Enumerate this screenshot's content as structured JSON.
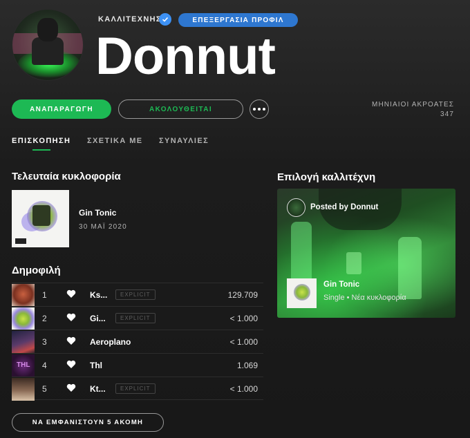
{
  "header": {
    "artist_label": "ΚΑΛΛΙΤΕΧΝΗΣ",
    "edit_profile_label": "ΕΠΕΞΕΡΓΑΣΙΑ ΠΡΟΦΙΛ",
    "artist_name": "Donnut"
  },
  "actions": {
    "play_label": "ΑΝΑΠΑΡΑΓΩΓΗ",
    "follow_label": "ΑΚΟΛΟΥΘΕΙΤΑΙ",
    "more_icon": "more-options-icon",
    "monthly_listeners_label": "ΜΗΝΙΑΙΟΙ ΑΚΡΟΑΤΕΣ",
    "monthly_listeners_value": "347"
  },
  "tabs": [
    {
      "label": "ΕΠΙΣΚΟΠΗΣΗ",
      "active": true
    },
    {
      "label": "ΣΧΕΤΙΚΑ ΜΕ",
      "active": false
    },
    {
      "label": "ΣΥΝΑΥΛΙΕΣ",
      "active": false
    }
  ],
  "latest_release": {
    "heading": "Τελευταία κυκλοφορία",
    "title": "Gin Tonic",
    "date": "30 ΜΑΪ 2020"
  },
  "popular": {
    "heading": "Δημοφιλή",
    "tracks": [
      {
        "num": "1",
        "title": "Ks...",
        "explicit": "EXPLICIT",
        "plays": "129.709"
      },
      {
        "num": "2",
        "title": "Gi...",
        "explicit": "EXPLICIT",
        "plays": "< 1.000"
      },
      {
        "num": "3",
        "title": "Aeroplano",
        "explicit": "",
        "plays": "< 1.000"
      },
      {
        "num": "4",
        "title": "Thl",
        "explicit": "",
        "plays": "1.069"
      },
      {
        "num": "5",
        "title": "Kt...",
        "explicit": "EXPLICIT",
        "plays": "< 1.000"
      }
    ],
    "show_more_label": "ΝΑ ΕΜΦΑΝΙΣΤΟΥΝ 5 ΑΚΟΜΗ"
  },
  "artist_pick": {
    "heading": "Επιλογή καλλιτέχνη",
    "posted_by": "Posted by Donnut",
    "title": "Gin Tonic",
    "subtitle": "Single • Νέα κυκλοφορία"
  },
  "colors": {
    "accent_green": "#1db954",
    "verified_blue": "#3d91f4",
    "edit_button_blue": "#2e77d0",
    "background": "#181818"
  }
}
